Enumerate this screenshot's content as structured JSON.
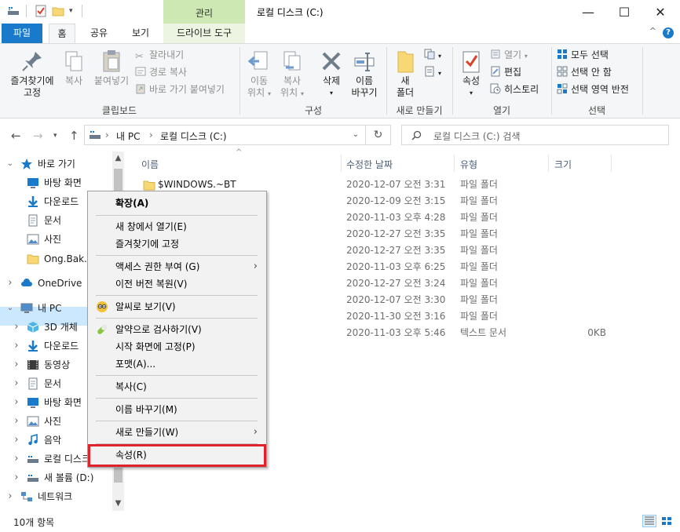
{
  "titlebar": {
    "context_tab": "관리",
    "title": "로컬 디스크 (C:)",
    "minimize_glyph": "—",
    "maximize_glyph": "☐",
    "close_glyph": "✕"
  },
  "tabs": {
    "file": "파일",
    "home": "홈",
    "share": "공유",
    "view": "보기",
    "drive_tools": "드라이브 도구"
  },
  "ribbon": {
    "clipboard": {
      "pin_line1": "즐겨찾기에",
      "pin_line2": "고정",
      "copy": "복사",
      "paste": "붙여넣기",
      "cut": "잘라내기",
      "copy_path": "경로 복사",
      "paste_shortcut": "바로 가기 붙여넣기",
      "group": "클립보드"
    },
    "organize": {
      "move_line1": "이동",
      "move_line2": "위치",
      "copyto_line1": "복사",
      "copyto_line2": "위치",
      "delete": "삭제",
      "rename_line1": "이름",
      "rename_line2": "바꾸기",
      "group": "구성"
    },
    "new": {
      "folder_line1": "새",
      "folder_line2": "폴더",
      "group": "새로 만들기"
    },
    "open": {
      "properties": "속성",
      "open": "열기",
      "edit": "편집",
      "history": "히스토리",
      "group": "열기"
    },
    "select": {
      "all": "모두 선택",
      "none": "선택 안 함",
      "invert": "선택 영역 반전",
      "group": "선택"
    }
  },
  "address": {
    "path_root": "내 PC",
    "path_drive": "로컬 디스크 (C:)",
    "search_placeholder": "로컬 디스크 (C:) 검색"
  },
  "navpane": {
    "items": [
      {
        "label": "바로 가기",
        "icon": "star-icon",
        "level": 0,
        "chevron": "open"
      },
      {
        "label": "바탕 화면",
        "icon": "desktop-icon",
        "level": 1,
        "chevron": "none"
      },
      {
        "label": "다운로드",
        "icon": "download-icon",
        "level": 1,
        "chevron": "none"
      },
      {
        "label": "문서",
        "icon": "document-icon",
        "level": 1,
        "chevron": "none"
      },
      {
        "label": "사진",
        "icon": "pictures-icon",
        "level": 1,
        "chevron": "none"
      },
      {
        "label": "Ong.Bak.3",
        "icon": "folder-icon",
        "level": 1,
        "chevron": "none"
      },
      {
        "label": "OneDrive",
        "icon": "cloud-icon",
        "level": 0,
        "chevron": "closed"
      },
      {
        "label": "내 PC",
        "icon": "pc-icon",
        "level": 0,
        "chevron": "open"
      },
      {
        "label": "3D 개체",
        "icon": "cube-icon",
        "level": 1,
        "chevron": "closed"
      },
      {
        "label": "다운로드",
        "icon": "download-icon",
        "level": 1,
        "chevron": "closed"
      },
      {
        "label": "동영상",
        "icon": "video-icon",
        "level": 1,
        "chevron": "closed"
      },
      {
        "label": "문서",
        "icon": "document-icon",
        "level": 1,
        "chevron": "closed"
      },
      {
        "label": "바탕 화면",
        "icon": "desktop-icon",
        "level": 1,
        "chevron": "closed"
      },
      {
        "label": "사진",
        "icon": "pictures-icon",
        "level": 1,
        "chevron": "closed"
      },
      {
        "label": "음악",
        "icon": "music-icon",
        "level": 1,
        "chevron": "closed"
      },
      {
        "label": "로컬 디스크 (C:)",
        "icon": "drive-icon",
        "level": 1,
        "chevron": "closed",
        "selected": true
      },
      {
        "label": "새 볼륨 (D:)",
        "icon": "drive-icon",
        "level": 1,
        "chevron": "closed"
      },
      {
        "label": "네트워크",
        "icon": "network-icon",
        "level": 0,
        "chevron": "closed"
      }
    ]
  },
  "filelist": {
    "headers": {
      "name": "이름",
      "date": "수정한 날짜",
      "type": "유형",
      "size": "크기"
    },
    "rows": [
      {
        "name": "$WINDOWS.~BT",
        "date": "2020-12-07 오전 3:31",
        "type": "파일 폴더",
        "size": ""
      },
      {
        "name": "",
        "date": "2020-12-09 오전 3:15",
        "type": "파일 폴더",
        "size": ""
      },
      {
        "name": "",
        "date": "2020-11-03 오후 4:28",
        "type": "파일 폴더",
        "size": ""
      },
      {
        "name": "",
        "date": "2020-12-27 오전 3:35",
        "type": "파일 폴더",
        "size": ""
      },
      {
        "name": "",
        "date": "2020-12-27 오전 3:35",
        "type": "파일 폴더",
        "size": ""
      },
      {
        "name": "",
        "date": "2020-11-03 오후 6:25",
        "type": "파일 폴더",
        "size": ""
      },
      {
        "name": "",
        "date": "2020-12-27 오전 3:24",
        "type": "파일 폴더",
        "size": ""
      },
      {
        "name": "",
        "date": "2020-12-07 오전 3:30",
        "type": "파일 폴더",
        "size": ""
      },
      {
        "name": "",
        "date": "2020-11-30 오전 3:16",
        "type": "파일 폴더",
        "size": ""
      },
      {
        "name": "",
        "date": "2020-11-03 오후 5:46",
        "type": "텍스트 문서",
        "size": "0KB"
      }
    ]
  },
  "context_menu": {
    "expand": "확장(A)",
    "open_new_window": "새 창에서 열기(E)",
    "pin_quick": "즐겨찾기에 고정",
    "give_access": "액세스 권한 부여 (G)",
    "restore_prev": "이전 버전 복원(V)",
    "alzip_view": "알씨로 보기(V)",
    "alyac_scan": "알약으로 검사하기(V)",
    "pin_start": "시작 화면에 고정(P)",
    "format": "포맷(A)...",
    "copy": "복사(C)",
    "rename": "이름 바꾸기(M)",
    "new": "새로 만들기(W)",
    "properties": "속성(R)",
    "highlight_color": "#e0222a"
  },
  "status": {
    "item_count": "10개 항목"
  },
  "colors": {
    "file_tab": "#1979ca",
    "tool_tab": "#cde8b2",
    "selection": "#cce8ff"
  }
}
